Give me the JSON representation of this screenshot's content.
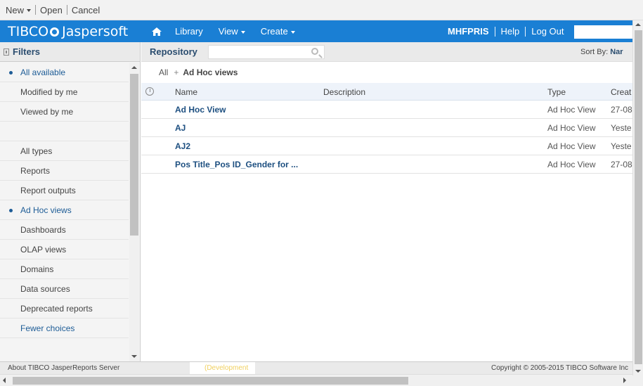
{
  "toolbar": {
    "new_label": "New",
    "open_label": "Open",
    "cancel_label": "Cancel"
  },
  "header": {
    "logo_tibco": "TIBCO",
    "logo_product": "Jaspersoft",
    "nav": {
      "library": "Library",
      "view": "View",
      "create": "Create"
    },
    "user": "MHFPRIS",
    "help": "Help",
    "logout": "Log Out",
    "search_placeholder": ""
  },
  "filters": {
    "title": "Filters",
    "groups": [
      [
        "All available",
        "Modified by me",
        "Viewed by me"
      ],
      [
        "All types",
        "Reports",
        "Report outputs",
        "Ad Hoc views",
        "Dashboards",
        "OLAP views",
        "Domains",
        "Data sources",
        "Deprecated reports"
      ]
    ],
    "selected": [
      "All available",
      "Ad Hoc views"
    ],
    "fewer_choices": "Fewer choices"
  },
  "repository": {
    "title": "Repository",
    "search_placeholder": "",
    "sort_label": "Sort By:",
    "sort_value": "Nar",
    "breadcrumb_root": "All",
    "breadcrumb_current": "Ad Hoc views",
    "columns": {
      "name": "Name",
      "description": "Description",
      "type": "Type",
      "created": "Creat"
    },
    "rows": [
      {
        "name": "Ad Hoc View",
        "description": "",
        "type": "Ad Hoc View",
        "created": "27-08"
      },
      {
        "name": "AJ",
        "description": "",
        "type": "Ad Hoc View",
        "created": "Yeste"
      },
      {
        "name": "AJ2",
        "description": "",
        "type": "Ad Hoc View",
        "created": "Yeste"
      },
      {
        "name": "Pos Title_Pos ID_Gender for ...",
        "description": "",
        "type": "Ad Hoc View",
        "created": "27-08"
      }
    ]
  },
  "footer": {
    "about": "About TIBCO JasperReports Server",
    "dev_badge": "(Development",
    "copyright": "Copyright © 2005-2015 TIBCO Software Inc"
  },
  "colors": {
    "header_bg": "#1a7fd4",
    "link": "#1d5c96",
    "panel_title": "#2b4d6f"
  }
}
